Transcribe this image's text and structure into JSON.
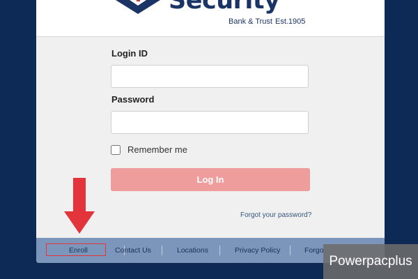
{
  "brand": {
    "name": "Security",
    "subtitle": "Bank & Trust",
    "established": "Est.1905"
  },
  "form": {
    "login_id_label": "Login ID",
    "login_id_value": "",
    "password_label": "Password",
    "password_value": "",
    "remember_label": "Remember me",
    "remember_checked": false,
    "login_button": "Log In",
    "forgot_link": "Forgot your password?"
  },
  "footer": {
    "links": [
      "Enroll",
      "Contact Us",
      "Locations",
      "Privacy Policy",
      "Forgo"
    ]
  },
  "annotation": {
    "arrow_color": "#e3343c",
    "highlight": "Enroll"
  },
  "watermark": "Powerpacplus",
  "colors": {
    "page_bg": "#0c2a55",
    "brand_navy": "#1b3466",
    "brand_red": "#c8343c",
    "login_button": "#ef9c9c",
    "footer_bar": "#7b95bb"
  }
}
